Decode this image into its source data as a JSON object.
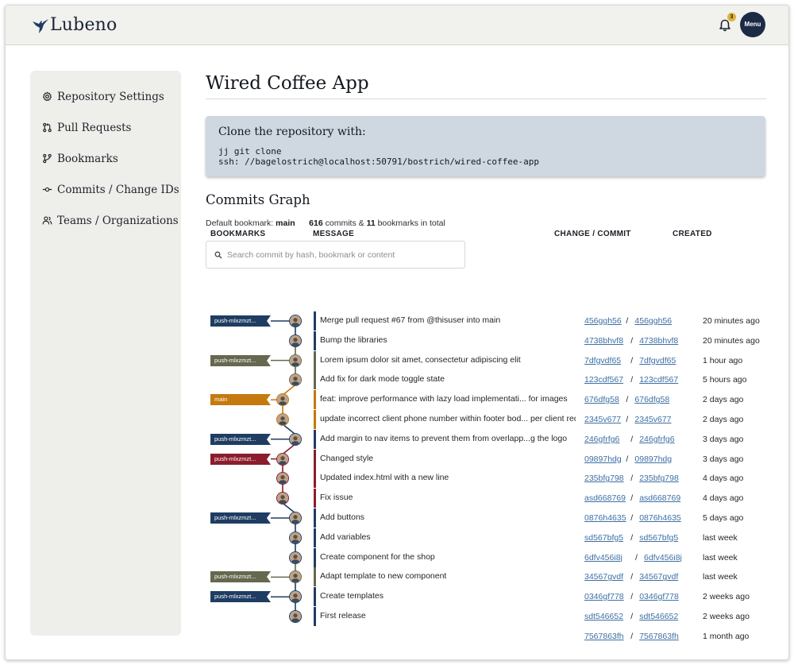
{
  "app": {
    "name": "Lubeno",
    "notification_count": "3",
    "menu_label": "Menu"
  },
  "colors": {
    "blue": "#1f3d62",
    "olive": "#66684f",
    "orange": "#c5790f",
    "red": "#8b1d2c",
    "navy": "#1b2b45"
  },
  "sidebar": {
    "items": [
      {
        "label": "Repository Settings",
        "icon": "gear-icon"
      },
      {
        "label": "Pull Requests",
        "icon": "pull-request-icon"
      },
      {
        "label": "Bookmarks",
        "icon": "branch-icon"
      },
      {
        "label": "Commits / Change IDs",
        "icon": "commit-icon"
      },
      {
        "label": "Teams / Organizations",
        "icon": "users-icon"
      }
    ]
  },
  "repo": {
    "title": "Wired Coffee App",
    "clone_title": "Clone the repository with:",
    "clone_line1": "jj git clone",
    "clone_line2": "ssh: //bagelostrich@localhost:50791/bostrich/wired-coffee-app"
  },
  "graph": {
    "title": "Commits Graph",
    "summary": {
      "default_label": "Default bookmark:",
      "default_bookmark": "main",
      "commit_count": "616",
      "commits_label": "commits &",
      "bookmark_count": "11",
      "bookmarks_label": "bookmarks in total"
    },
    "search_placeholder": "Search commit by hash, bookmark or content",
    "columns": {
      "bookmarks": "BOOKMARKS",
      "message": "MESSAGE",
      "change": "CHANGE / COMMIT",
      "created": "CREATED"
    },
    "commits": [
      {
        "bookmark": "push-mlxzmzt...",
        "lane": "blue",
        "message": "Merge pull request #67 from @thisuser into main",
        "change": "456ggh56",
        "commit": "456ggh56",
        "created": "20 minutes ago"
      },
      {
        "bookmark": "",
        "lane": "blue",
        "message": "Bump the libraries",
        "change": "4738bhvf8",
        "commit": "4738bhvf8",
        "created": "20 minutes ago"
      },
      {
        "bookmark": "push-mlxzmzt...",
        "lane": "olive",
        "message": "Lorem ipsum dolor sit amet, consectetur adipiscing elit",
        "change": "7dfgvdf65",
        "commit": "7dfgvdf65",
        "created": "1 hour ago"
      },
      {
        "bookmark": "",
        "lane": "olive",
        "message": "Add fix for dark mode toggle state",
        "change": "123cdf567",
        "commit": "123cdf567",
        "created": "5 hours ago"
      },
      {
        "bookmark": "main",
        "lane": "orange",
        "message": "feat: improve performance with lazy load implementati... for images",
        "change": "676dfg58",
        "commit": "676dfg58",
        "created": "2 days ago"
      },
      {
        "bookmark": "",
        "lane": "orange",
        "message": "update incorrect client phone number within footer bod... per client request",
        "change": "2345v677",
        "commit": "2345v677",
        "created": "2 days ago"
      },
      {
        "bookmark": "push-mlxzmzt...",
        "lane": "blue",
        "message": "Add margin to nav items to prevent them from overlapp...g the logo",
        "change": "246gfrfg6",
        "commit": "246gfrfg6",
        "created": "3 days ago"
      },
      {
        "bookmark": "push-mlxzmzt...",
        "lane": "red",
        "message": "Changed style",
        "change": "09897hdg",
        "commit": "09897hdg",
        "created": "3 days ago"
      },
      {
        "bookmark": "",
        "lane": "red",
        "message": "Updated index.html with a new line",
        "change": "235bfg798",
        "commit": "235bfg798",
        "created": "4 days ago"
      },
      {
        "bookmark": "",
        "lane": "red",
        "message": "Fix issue",
        "change": "asd668769",
        "commit": "asd668769",
        "created": "4 days ago"
      },
      {
        "bookmark": "push-mlxzmzt...",
        "lane": "blue",
        "message": "Add buttons",
        "change": "0876h4635",
        "commit": "0876h4635",
        "created": "5 days ago"
      },
      {
        "bookmark": "",
        "lane": "blue",
        "message": "Add variables",
        "change": "sd567bfg5",
        "commit": "sd567bfg5",
        "created": "last week"
      },
      {
        "bookmark": "",
        "lane": "blue",
        "message": "Create component for the shop",
        "change": "6dfv456i8j",
        "commit": "6dfv456i8j",
        "created": "last week"
      },
      {
        "bookmark": "push-mlxzmzt...",
        "lane": "olive",
        "message": "Adapt template to new component",
        "change": "34567gvdf",
        "commit": "34567gvdf",
        "created": "last week"
      },
      {
        "bookmark": "push-mlxzmzt...",
        "lane": "blue",
        "message": "Create templates",
        "change": "0346gf778",
        "commit": "0346gf778",
        "created": "2 weeks ago"
      },
      {
        "bookmark": "",
        "lane": "blue",
        "message": "First release",
        "change": "sdt546652",
        "commit": "sdt546652",
        "created": "2 weeks ago"
      },
      {
        "bookmark": "",
        "lane": "",
        "message": "",
        "change": "7567863fh",
        "commit": "7567863fh",
        "created": "1 month ago"
      }
    ]
  }
}
